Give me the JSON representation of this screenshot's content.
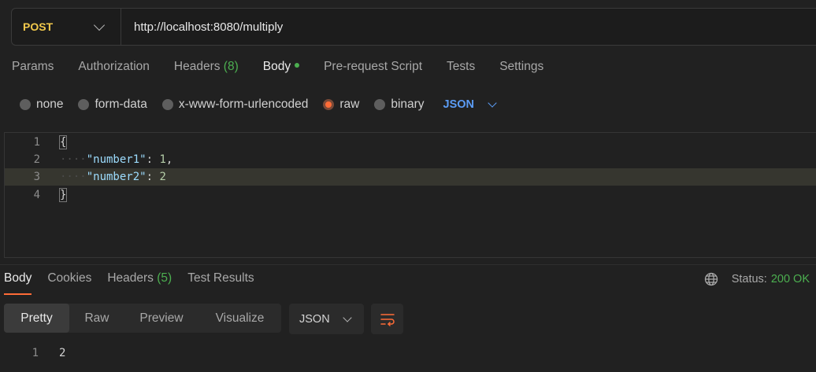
{
  "request": {
    "method": "POST",
    "url": "http://localhost:8080/multiply"
  },
  "request_tabs": [
    {
      "label": "Params"
    },
    {
      "label": "Authorization"
    },
    {
      "label": "Headers",
      "count": "(8)"
    },
    {
      "label": "Body",
      "active": true,
      "modified_dot": true
    },
    {
      "label": "Pre-request Script"
    },
    {
      "label": "Tests"
    },
    {
      "label": "Settings"
    }
  ],
  "body_types": [
    {
      "label": "none"
    },
    {
      "label": "form-data"
    },
    {
      "label": "x-www-form-urlencoded"
    },
    {
      "label": "raw",
      "selected": true
    },
    {
      "label": "binary"
    }
  ],
  "body_format": "JSON",
  "editor": {
    "line_numbers": [
      "1",
      "2",
      "3",
      "4"
    ],
    "open_brace": "{",
    "close_brace": "}",
    "indent": "····",
    "key1": "\"number1\"",
    "value1": "1",
    "key2": "\"number2\"",
    "value2": "2",
    "colon": ": ",
    "comma": ","
  },
  "response_tabs": [
    {
      "label": "Body",
      "active": true
    },
    {
      "label": "Cookies"
    },
    {
      "label": "Headers",
      "count": "(5)"
    },
    {
      "label": "Test Results"
    }
  ],
  "status": {
    "label": "Status:",
    "value": "200 OK"
  },
  "view_modes": [
    "Pretty",
    "Raw",
    "Preview",
    "Visualize"
  ],
  "response_format": "JSON",
  "response_body": {
    "line_number": "1",
    "value": "2"
  },
  "colors": {
    "accent": "#ff6c37",
    "method": "#f2c94c",
    "success": "#4caf50",
    "link_blue": "#5b9cf5"
  }
}
